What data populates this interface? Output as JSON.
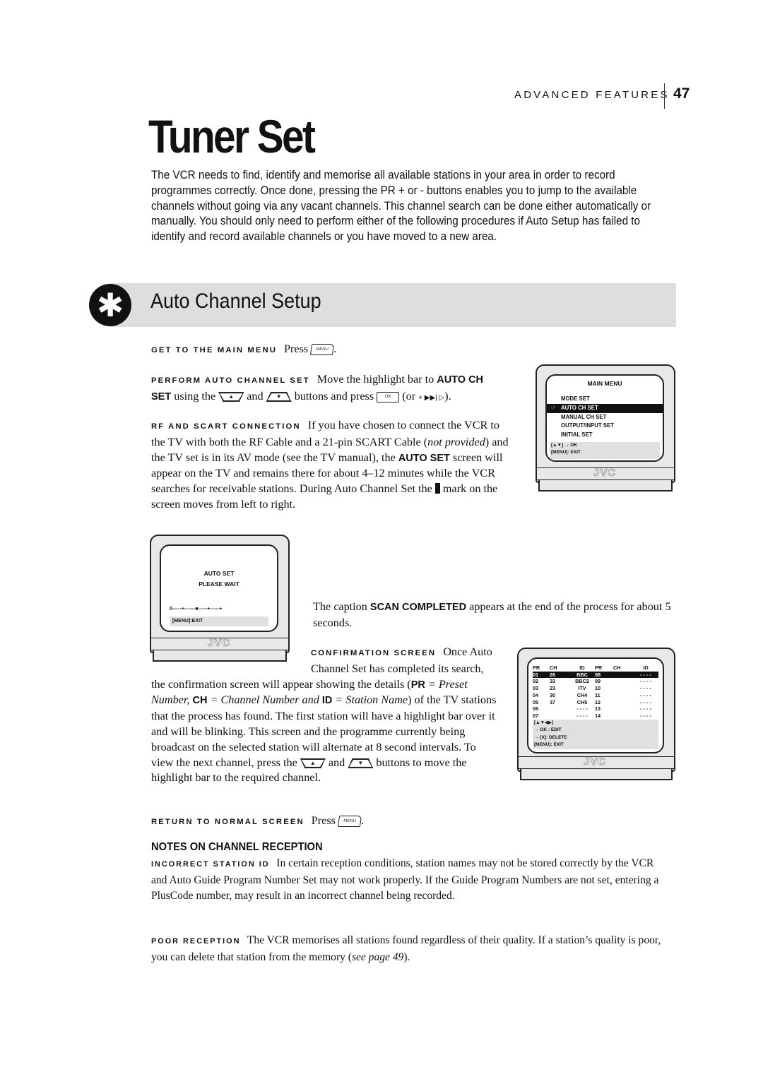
{
  "header": {
    "section": "ADVANCED FEATURES",
    "page_number": "47"
  },
  "title": "Tuner Set",
  "intro": "The VCR needs to find, identify and memorise all available stations in your area in order to record programmes correctly. Once done, pressing the PR + or - buttons enables you to jump to the available channels without going via any vacant channels. This channel search can be done either automatically or manually. You should only need to perform either of the following procedures if Auto Setup has failed to identify and record available channels or you have moved to a new area.",
  "section": {
    "icon": "asterisk-icon",
    "title": "Auto Channel Setup"
  },
  "steps": {
    "main_menu": {
      "lead": "GET TO THE MAIN MENU",
      "text": "Press",
      "button": "MENU",
      "end": "."
    },
    "perform": {
      "lead": "PERFORM AUTO CHANNEL SET",
      "t1": "Move the highlight bar to",
      "b1": "AUTO CH SET",
      "t2": "using the",
      "up_button": "▲",
      "t3": "and",
      "down_button": "▼",
      "t4": "buttons and press",
      "ok_button": "OK",
      "t5": "(or",
      "alt_buttons": "+ ▶▶| ▷",
      "t6": ")."
    },
    "rf_scart": {
      "lead": "RF AND SCART CONNECTION",
      "t1": "If you have chosen to connect the VCR to the TV with both the RF Cable and a 21-pin SCART Cable (",
      "i1": "not provided",
      "t2": ") and the TV set is in its AV mode (see the TV manual), the",
      "b1": "AUTO SET",
      "t3": "screen will appear on the TV and remains there for about 4–12 minutes while the VCR searches for receivable stations. During Auto Channel Set the",
      "t4": "mark on the screen moves from left to right."
    },
    "scan_completed": {
      "t1": "The caption",
      "b1": "SCAN COMPLETED",
      "t2": "appears at the end of the process for about 5 seconds."
    },
    "confirmation": {
      "lead": "CONFIRMATION SCREEN",
      "t1": "Once Auto Channel Set has completed its search, the confirmation screen will appear showing the details (",
      "b_pr": "PR",
      "i_pr": " = Preset Number, ",
      "b_ch": "CH",
      "i_ch": " = Channel Number and ",
      "b_id": "ID",
      "i_id": " = Station Name",
      "t2": ") of the TV stations that the process has found. The first station will have a highlight bar over it and will be blinking. This screen and the programme currently being broadcast on the selected station will alternate at 8 second intervals. To view the next channel, press the",
      "t3": "and",
      "t4": "buttons to move the highlight bar to the required channel."
    },
    "return": {
      "lead": "RETURN TO NORMAL SCREEN",
      "text": "Press",
      "button": "MENU",
      "end": "."
    }
  },
  "notes": {
    "heading": "NOTES ON CHANNEL RECEPTION",
    "incorrect_id": {
      "lead": "INCORRECT STATION ID",
      "text": "In certain reception conditions, station names may not be stored correctly by the VCR and Auto Guide Program Number Set may not work properly. If  the Guide Program Numbers are not set, entering a PlusCode number, may result in an incorrect channel being recorded."
    },
    "poor_reception": {
      "lead": "POOR RECEPTION",
      "text": "The VCR memorises all stations found regardless of their quality. If a station’s quality is poor, you can delete that station from the memory (",
      "link": "see page 49",
      "end": ")."
    }
  },
  "tv_main_menu": {
    "brand": "JVC",
    "title": "MAIN MENU",
    "items": [
      "MODE SET",
      "AUTO CH SET",
      "MANUAL CH SET",
      "OUTPUT/INPUT SET",
      "INITIAL SET"
    ],
    "selected_index": 1,
    "pointer_icon": "☞",
    "footer": [
      "[▲▼] → OK",
      "[MENU]: EXIT"
    ]
  },
  "tv_auto_set": {
    "brand": "JVC",
    "line1": "AUTO SET",
    "line2": "PLEASE WAIT",
    "progress_scale": "0-----+------■-----+-----+",
    "progress_fraction": 0.5,
    "footer": "[MENU]:EXIT"
  },
  "tv_confirmation": {
    "brand": "JVC",
    "headers": [
      "PR",
      "CH",
      "ID",
      "PR",
      "CH",
      "ID"
    ],
    "rows": [
      [
        "01",
        "26",
        "BBC",
        "08",
        "",
        "- - - -"
      ],
      [
        "02",
        "33",
        "BBC2",
        "09",
        "",
        "- - - -"
      ],
      [
        "03",
        "23",
        "ITV",
        "10",
        "",
        "- - - -"
      ],
      [
        "04",
        "30",
        "CH4",
        "11",
        "",
        "- - - -"
      ],
      [
        "05",
        "37",
        "CH5",
        "12",
        "",
        "- - - -"
      ],
      [
        "06",
        "",
        "- - - -",
        "13",
        "",
        "- - - -"
      ],
      [
        "07",
        "",
        "- - - -",
        "14",
        "",
        "- - - -"
      ]
    ],
    "selected_row": 0,
    "footer": [
      "[▲▼◀▶]",
      "→ OK : EDIT",
      "→ [X]: DELETE",
      "[MENU]: EXIT"
    ]
  }
}
